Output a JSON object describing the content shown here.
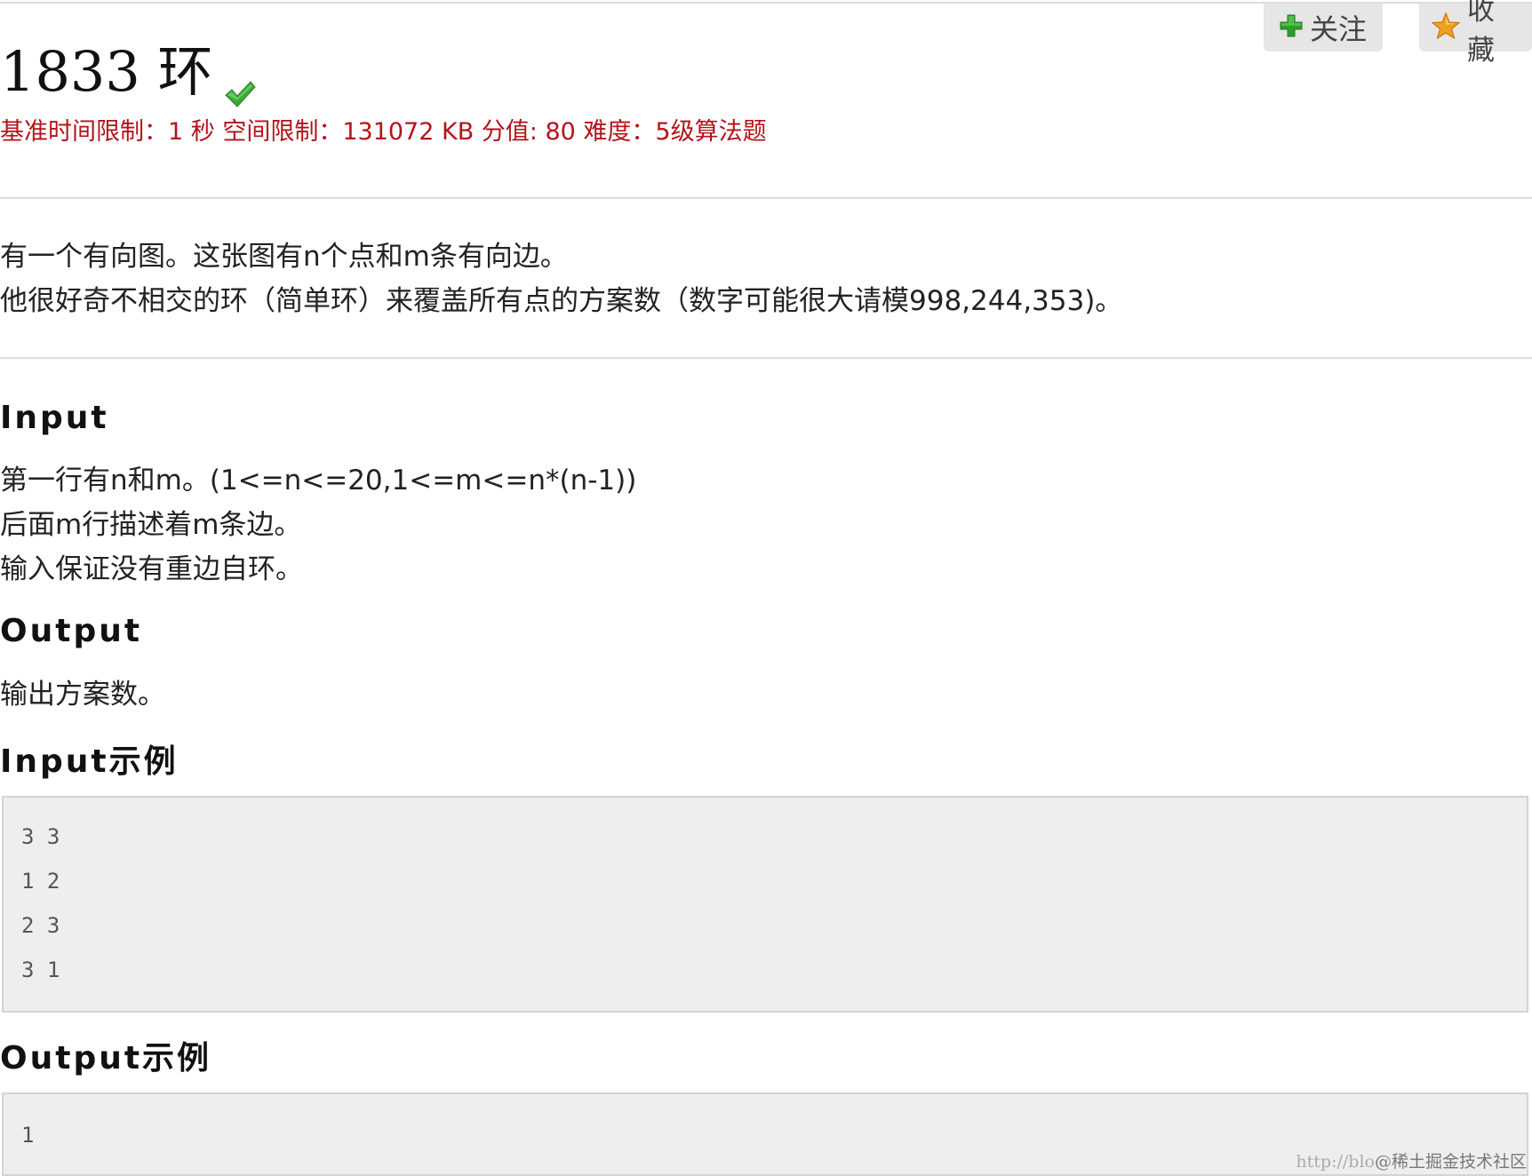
{
  "header": {
    "title": "1833 环",
    "meta": "基准时间限制：1 秒 空间限制：131072 KB 分值: 80 难度：5级算法题"
  },
  "actions": {
    "follow_label": "关注",
    "favorite_label": "收藏"
  },
  "icons": {
    "follow": "green-plus-icon",
    "favorite": "star-icon",
    "status": "green-check-icon"
  },
  "colors": {
    "meta_text": "#b5121b",
    "check": "#3aaa35",
    "plus": "#2e9f2a",
    "star": "#f0a020"
  },
  "description": [
    "有一个有向图。这张图有n个点和m条有向边。",
    "他很好奇不相交的环（简单环）来覆盖所有点的方案数（数字可能很大请模998,244,353)。"
  ],
  "input_section": {
    "heading": "Input",
    "lines": [
      "第一行有n和m。(1<=n<=20,1<=m<=n*(n-1))",
      "后面m行描述着m条边。",
      "输入保证没有重边自环。"
    ]
  },
  "output_section": {
    "heading": "Output",
    "lines": [
      "输出方案数。"
    ]
  },
  "input_example": {
    "heading": "Input示例",
    "lines": [
      "3 3",
      "1 2",
      "2 3",
      "3 1"
    ]
  },
  "output_example": {
    "heading": "Output示例",
    "lines": [
      "1"
    ]
  },
  "watermark": {
    "url_prefix": "http://blo",
    "brand": "@稀土掘金技术社区"
  }
}
